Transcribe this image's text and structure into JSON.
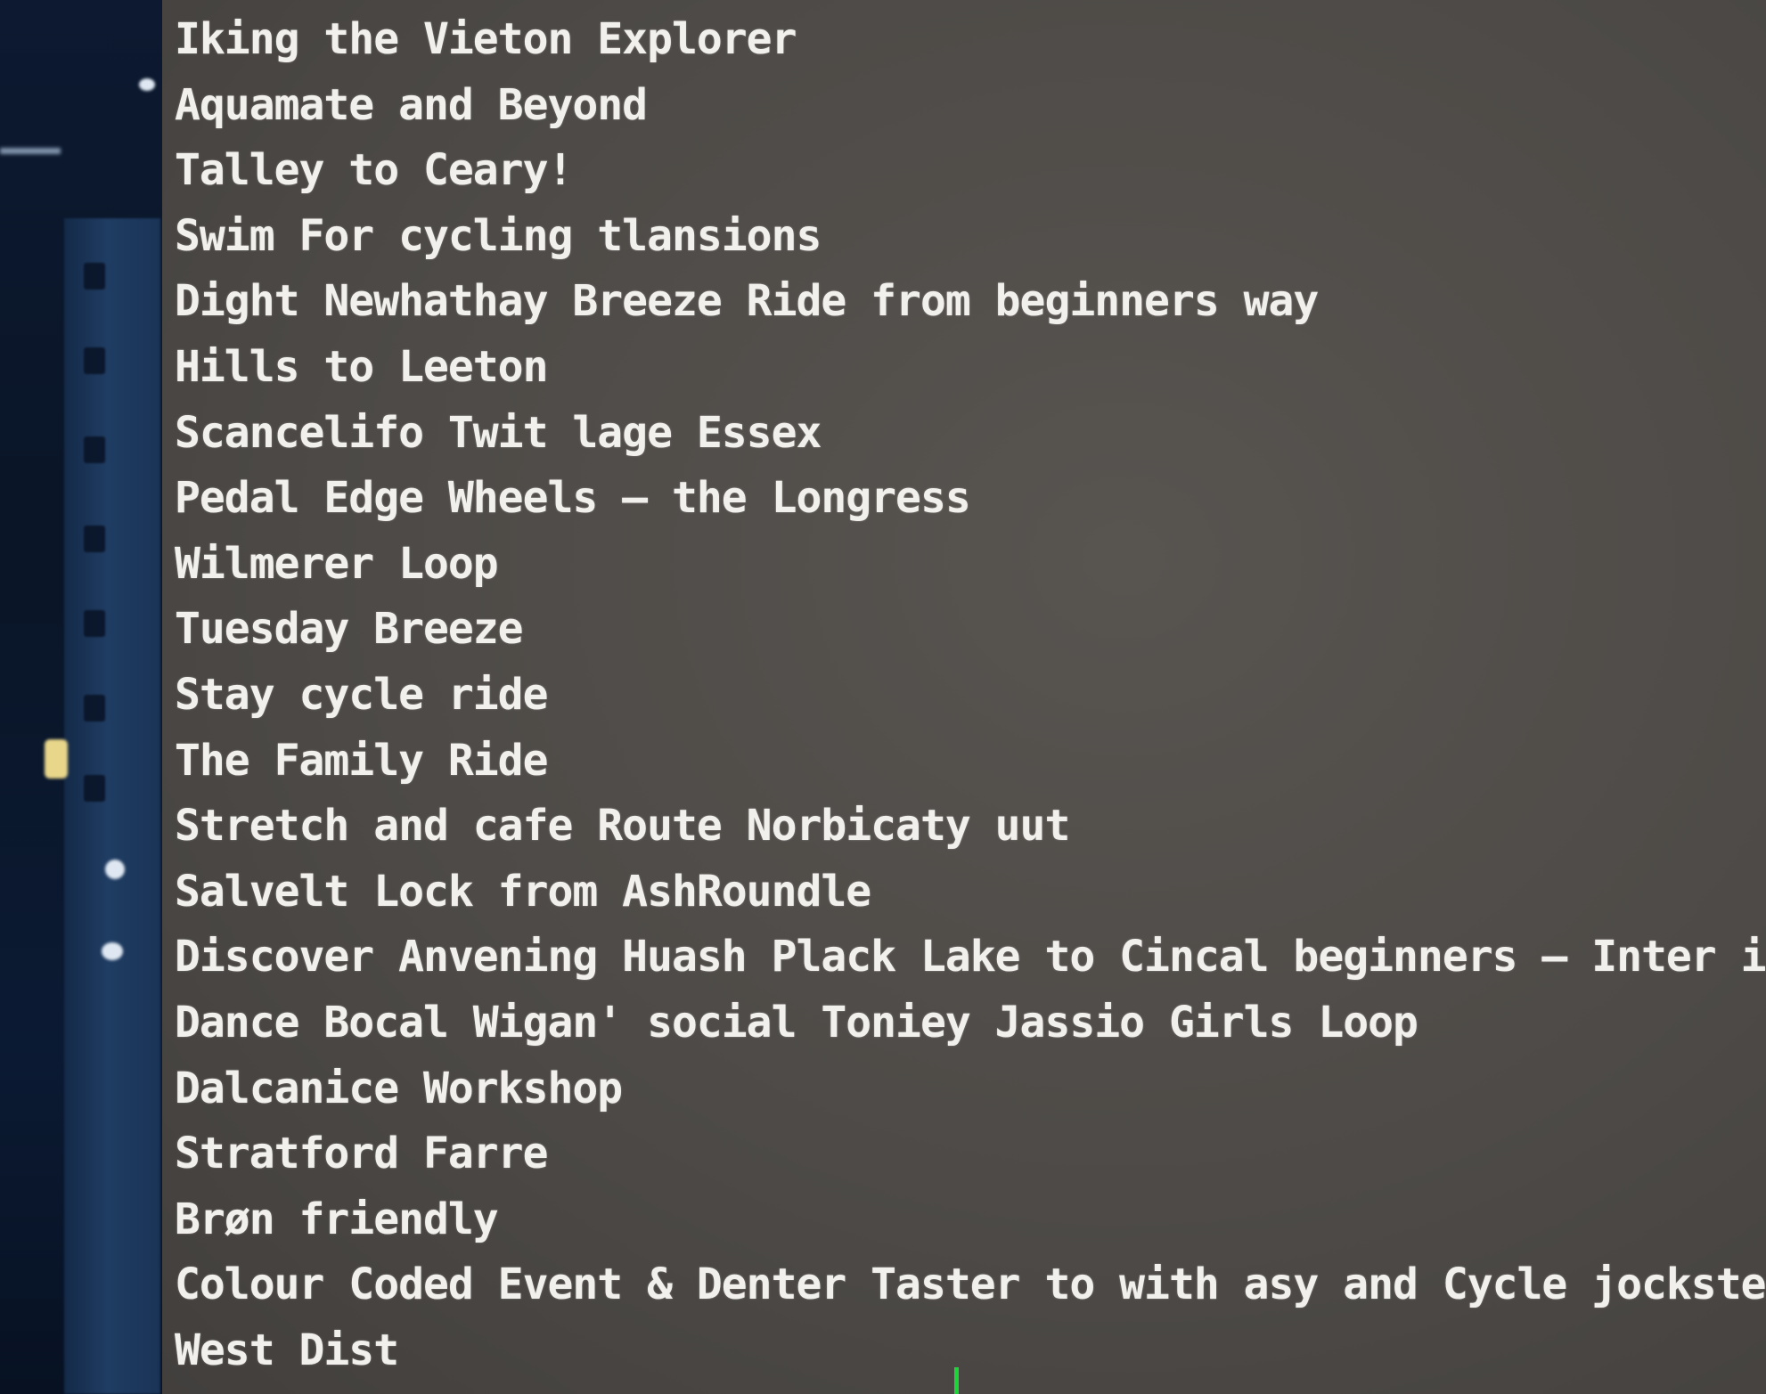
{
  "terminal": {
    "lines": [
      "Iking the Vieton Explorer",
      "Aquamate and Beyond",
      "Talley to Ceary!",
      "Swim For cycling tlansions",
      "Dight Newhathay Breeze Ride from beginners way",
      "Hills to Leeton",
      "Scancelifo Twit lage Essex",
      "Pedal Edge Wheels – the Longress",
      "Wilmerer Loop",
      "Tuesday Breeze",
      "Stay cycle ride",
      "The Family Ride",
      "Stretch and cafe Route Norbicaty uut",
      "Salvelt Lock from AshRoundle",
      "Discover Anvening Huash Plack Lake to Cincal beginners – Inter i",
      "Dance Bocal Wigan' social Toniey Jassio Girls Loop",
      "Dalcanice Workshop",
      "Stratford Farre",
      "Brøn friendly",
      "Colour Coded Event & Denter Taster to with asy and Cycle jockste",
      "West Dist"
    ],
    "text_color": "#f2f0ec",
    "background_color": "#4d4a47",
    "cursor_color": "#1fd43a"
  }
}
